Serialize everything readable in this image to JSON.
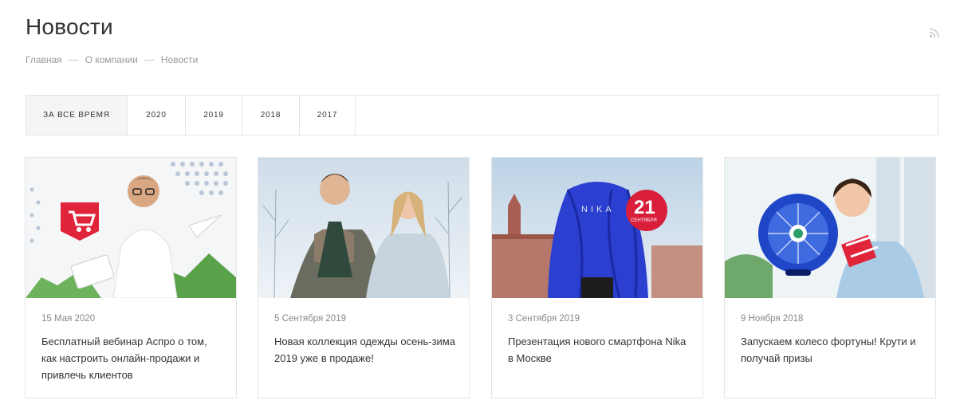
{
  "page": {
    "title": "Новости"
  },
  "breadcrumb": [
    "Главная",
    "О компании",
    "Новости"
  ],
  "filters": [
    {
      "label": "ЗА ВСЕ ВРЕМЯ",
      "active": true
    },
    {
      "label": "2020",
      "active": false
    },
    {
      "label": "2019",
      "active": false
    },
    {
      "label": "2018",
      "active": false
    },
    {
      "label": "2017",
      "active": false
    }
  ],
  "news": [
    {
      "date": "15 Мая 2020",
      "title": "Бесплатный вебинар Аспро о том, как настроить онлайн-продажи и привлечь клиентов",
      "image": "man-with-tablet-and-cart-badge"
    },
    {
      "date": "5 Сентября 2019",
      "title": "Новая коллекция одежды осень-зима 2019 уже в продаже!",
      "image": "couple-in-winter-coats"
    },
    {
      "date": "3 Сентября 2019",
      "title": "Презентация нового смартфона Nika в Москве",
      "image": "covered-phone-kremlin"
    },
    {
      "date": "9 Ноября 2018",
      "title": "Запускаем колесо фортуны! Крути и получай призы",
      "image": "woman-with-fortune-wheel-and-gift"
    }
  ],
  "images": {
    "nika_brand": "NIKA",
    "badge_day": "21",
    "badge_month": "сентября"
  },
  "icons": {
    "rss": "rss-icon",
    "cart": "cart-icon"
  },
  "colors": {
    "accent": "#e0243a",
    "border": "#e5e5e5",
    "muted_text": "#999999"
  }
}
